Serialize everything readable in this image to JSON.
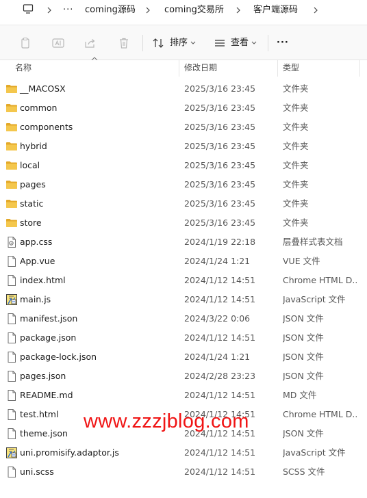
{
  "breadcrumb": {
    "more": "···",
    "items": [
      "coming源码",
      "coming交易所",
      "客户端源码"
    ]
  },
  "toolbar": {
    "sort_label": "排序",
    "view_label": "查看",
    "more_label": "···",
    "icons": [
      "copy-icon",
      "rename-icon",
      "share-icon",
      "delete-icon",
      "sort-icon",
      "view-icon"
    ]
  },
  "columns": {
    "name": "名称",
    "date": "修改日期",
    "type": "类型"
  },
  "files": [
    {
      "name": "__MACOSX",
      "date": "2025/3/16 23:45",
      "type": "文件夹",
      "icon": "folder"
    },
    {
      "name": "common",
      "date": "2025/3/16 23:45",
      "type": "文件夹",
      "icon": "folder"
    },
    {
      "name": "components",
      "date": "2025/3/16 23:45",
      "type": "文件夹",
      "icon": "folder"
    },
    {
      "name": "hybrid",
      "date": "2025/3/16 23:45",
      "type": "文件夹",
      "icon": "folder"
    },
    {
      "name": "local",
      "date": "2025/3/16 23:45",
      "type": "文件夹",
      "icon": "folder"
    },
    {
      "name": "pages",
      "date": "2025/3/16 23:45",
      "type": "文件夹",
      "icon": "folder"
    },
    {
      "name": "static",
      "date": "2025/3/16 23:45",
      "type": "文件夹",
      "icon": "folder"
    },
    {
      "name": "store",
      "date": "2025/3/16 23:45",
      "type": "文件夹",
      "icon": "folder"
    },
    {
      "name": "app.css",
      "date": "2024/1/19 22:18",
      "type": "层叠样式表文档",
      "icon": "css"
    },
    {
      "name": "App.vue",
      "date": "2024/1/24 1:21",
      "type": "VUE 文件",
      "icon": "file"
    },
    {
      "name": "index.html",
      "date": "2024/1/12 14:51",
      "type": "Chrome HTML D...",
      "icon": "file"
    },
    {
      "name": "main.js",
      "date": "2024/1/12 14:51",
      "type": "JavaScript 文件",
      "icon": "script"
    },
    {
      "name": "manifest.json",
      "date": "2024/3/22 0:06",
      "type": "JSON 文件",
      "icon": "file"
    },
    {
      "name": "package.json",
      "date": "2024/1/12 14:51",
      "type": "JSON 文件",
      "icon": "file"
    },
    {
      "name": "package-lock.json",
      "date": "2024/1/24 1:21",
      "type": "JSON 文件",
      "icon": "file"
    },
    {
      "name": "pages.json",
      "date": "2024/2/28 23:23",
      "type": "JSON 文件",
      "icon": "file"
    },
    {
      "name": "README.md",
      "date": "2024/1/12 14:51",
      "type": "MD 文件",
      "icon": "file"
    },
    {
      "name": "test.html",
      "date": "2024/1/12 14:51",
      "type": "Chrome HTML D...",
      "icon": "file"
    },
    {
      "name": "theme.json",
      "date": "2024/1/12 14:51",
      "type": "JSON 文件",
      "icon": "file"
    },
    {
      "name": "uni.promisify.adaptor.js",
      "date": "2024/1/12 14:51",
      "type": "JavaScript 文件",
      "icon": "script"
    },
    {
      "name": "uni.scss",
      "date": "2024/1/12 14:51",
      "type": "SCSS 文件",
      "icon": "file"
    }
  ],
  "watermark": "www.zzzjblog.com",
  "colors": {
    "folder": "#f4c74d",
    "folder_tab": "#e3a92a",
    "watermark": "#f01414",
    "toolbar_bg": "#f9f9f9"
  }
}
